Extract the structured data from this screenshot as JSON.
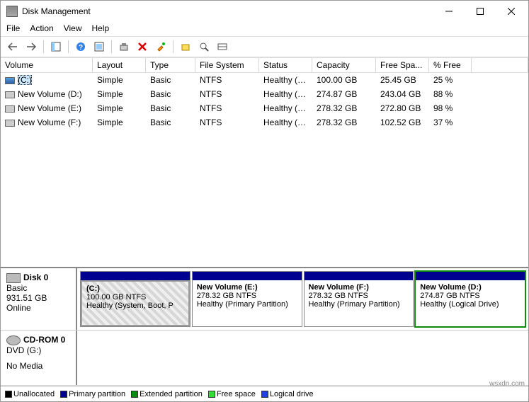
{
  "window": {
    "title": "Disk Management"
  },
  "menu": {
    "file": "File",
    "action": "Action",
    "view": "View",
    "help": "Help"
  },
  "columns": {
    "volume": "Volume",
    "layout": "Layout",
    "type": "Type",
    "fs": "File System",
    "status": "Status",
    "capacity": "Capacity",
    "free": "Free Spa...",
    "pct": "% Free"
  },
  "rows": [
    {
      "name": "(C:)",
      "layout": "Simple",
      "type": "Basic",
      "fs": "NTFS",
      "status": "Healthy (S...",
      "capacity": "100.00 GB",
      "free": "25.45 GB",
      "pct": "25 %",
      "selected": true,
      "primary": true
    },
    {
      "name": "New Volume (D:)",
      "layout": "Simple",
      "type": "Basic",
      "fs": "NTFS",
      "status": "Healthy (L...",
      "capacity": "274.87 GB",
      "free": "243.04 GB",
      "pct": "88 %",
      "selected": false,
      "primary": false
    },
    {
      "name": "New Volume (E:)",
      "layout": "Simple",
      "type": "Basic",
      "fs": "NTFS",
      "status": "Healthy (P...",
      "capacity": "278.32 GB",
      "free": "272.80 GB",
      "pct": "98 %",
      "selected": false,
      "primary": false
    },
    {
      "name": "New Volume (F:)",
      "layout": "Simple",
      "type": "Basic",
      "fs": "NTFS",
      "status": "Healthy (P...",
      "capacity": "278.32 GB",
      "free": "102.52 GB",
      "pct": "37 %",
      "selected": false,
      "primary": false
    }
  ],
  "disk0": {
    "title": "Disk 0",
    "type": "Basic",
    "size": "931.51 GB",
    "state": "Online",
    "parts": [
      {
        "label": "(C:)",
        "sub": "100.00 GB NTFS",
        "status": "Healthy (System, Boot, P",
        "hatch": true
      },
      {
        "label": "New Volume  (E:)",
        "sub": "278.32 GB NTFS",
        "status": "Healthy (Primary Partition)"
      },
      {
        "label": "New Volume  (F:)",
        "sub": "278.32 GB NTFS",
        "status": "Healthy (Primary Partition)"
      },
      {
        "label": "New Volume  (D:)",
        "sub": "274.87 GB NTFS",
        "status": "Healthy (Logical Drive)",
        "ext": true
      }
    ]
  },
  "cdrom": {
    "title": "CD-ROM 0",
    "sub": "DVD (G:)",
    "media": "No Media"
  },
  "legend": {
    "unalloc": "Unallocated",
    "primary": "Primary partition",
    "ext": "Extended partition",
    "free": "Free space",
    "logical": "Logical drive"
  },
  "watermark": "wsxdn.com"
}
